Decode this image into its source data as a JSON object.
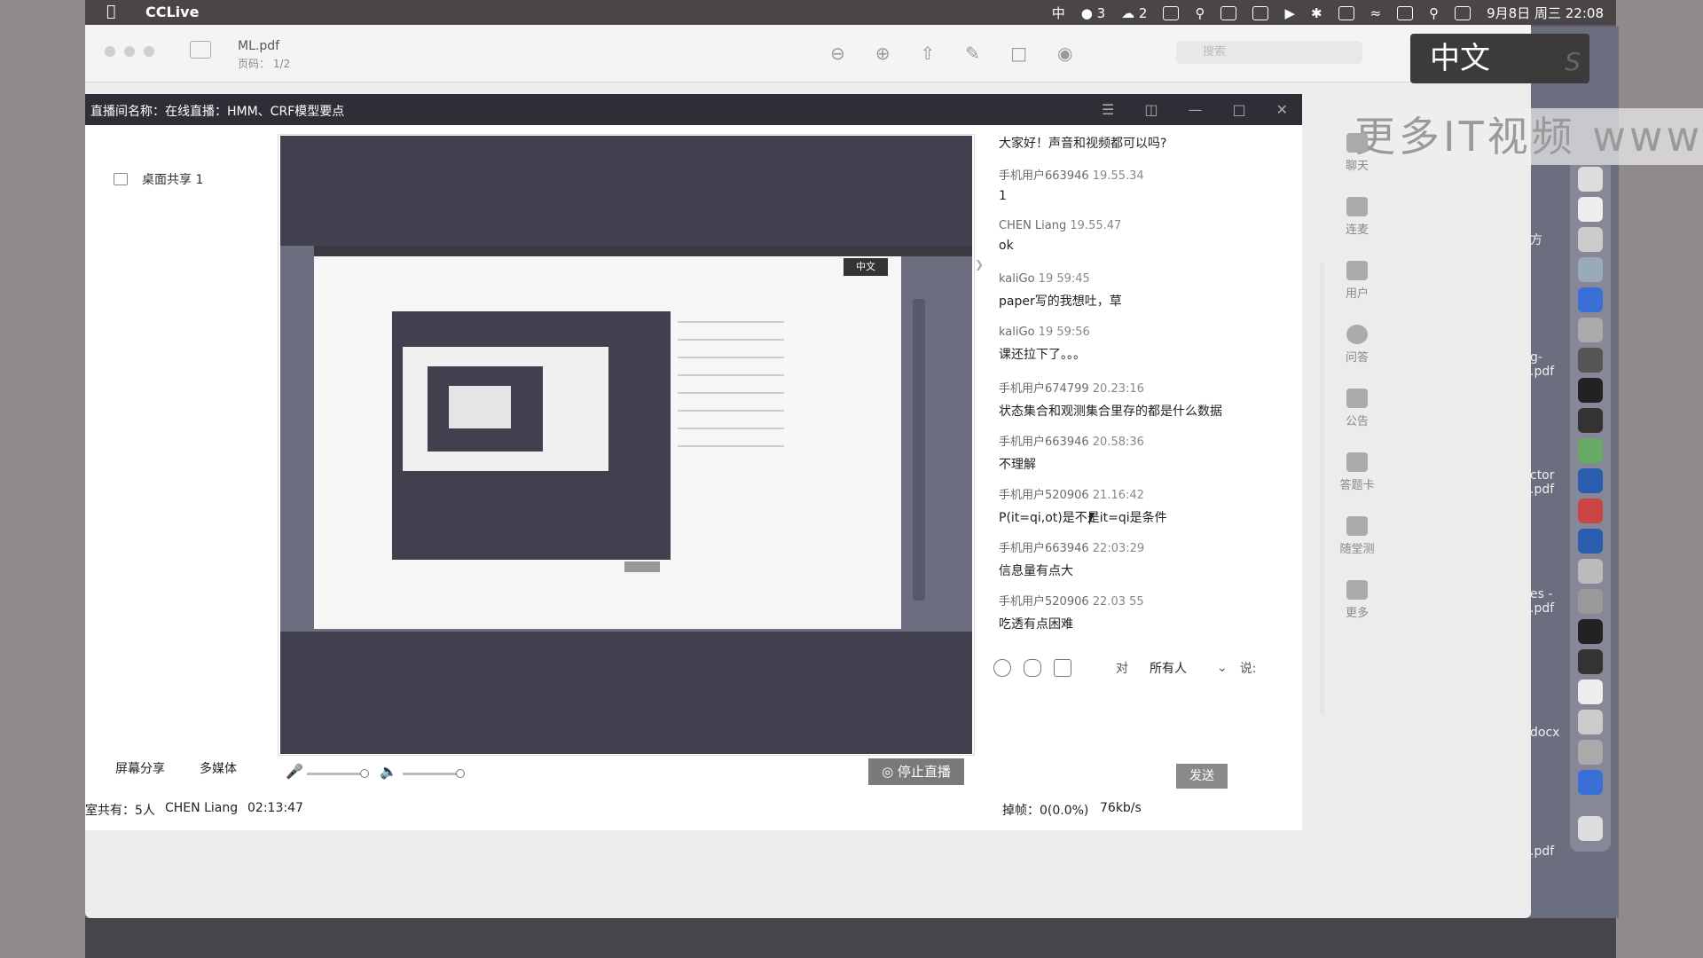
{
  "menubar": {
    "app_name": "CCLive",
    "ime": "中",
    "notify_count": "3",
    "wechat_count": "2",
    "datetime": "9月8日 周三 22:08"
  },
  "pdf": {
    "title": "ML.pdf",
    "page": "页码： 1/2",
    "search_placeholder": "搜索"
  },
  "ime_popup": {
    "label": "中文"
  },
  "watermark": "更多IT视频 www.u",
  "cclive": {
    "title": "直播间名称：在线直播：HMM、CRF模型要点",
    "share_item": "桌面共享 1",
    "inner_ime": "中文",
    "chat": [
      {
        "user": "",
        "time": "",
        "text": "大家好！声音和视频都可以吗?"
      },
      {
        "user": "手机用户663946",
        "time": "19.55.34",
        "text": "1"
      },
      {
        "user": "CHEN Liang",
        "time": "19.55.47",
        "text": "ok"
      },
      {
        "user": "kaliGo",
        "time": "19 59:45",
        "text": "paper写的我想吐，草"
      },
      {
        "user": "kaliGo",
        "time": "19 59:56",
        "text": "课还拉下了。。。"
      },
      {
        "user": "手机用户674799",
        "time": "20.23:16",
        "text": "状态集合和观测集合里存的都是什么数据"
      },
      {
        "user": "手机用户663946",
        "time": "20.58:36",
        "text": "不理解"
      },
      {
        "user": "手机用户520906",
        "time": "21.16:42",
        "text": "P(it=qi,ot)是不是it=qi是条件"
      },
      {
        "user": "手机用户663946",
        "time": "22:03:29",
        "text": "信息量有点大"
      },
      {
        "user": "手机用户520906",
        "time": "22.03 55",
        "text": "吃透有点困难"
      }
    ],
    "rail": [
      "聊天",
      "连麦",
      "用户",
      "问答",
      "公告",
      "答题卡",
      "随堂测",
      "更多"
    ],
    "to_label": "对",
    "to_target": "所有人",
    "say_label": "说:",
    "send_label": "发送",
    "screen_share": "屏幕分享",
    "multimedia": "多媒体",
    "stop_live": "停止直播",
    "status_count": "室共有：5人",
    "status_user": "CHEN Liang",
    "status_time": "02:13:47",
    "drop": "掉帧：0(0.0%)",
    "bitrate": "76kb/s"
  },
  "desktop_files": [
    "方",
    "g-\n.pdf",
    "ctor\n.pdf",
    "es -\n.pdf",
    "docx",
    ".pdf"
  ]
}
